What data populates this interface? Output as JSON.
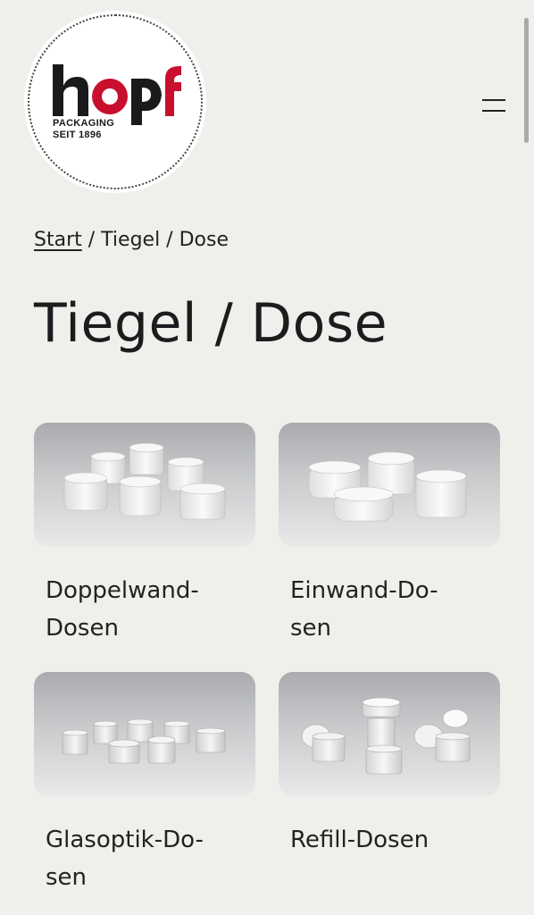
{
  "header": {
    "logo": {
      "wordmark": "hopf",
      "tagline_line1": "PACKAGING",
      "tagline_line2": "SEIT 1896"
    },
    "menu_icon": "hamburger-icon"
  },
  "breadcrumb": {
    "home_label": "Start",
    "separator": " / ",
    "current_label": "Tiegel / Dose"
  },
  "page_title": "Tiegel / Dose",
  "categories": [
    {
      "label": "Doppelwand-\nDosen",
      "image": "double-wall-jars-photo"
    },
    {
      "label": "Einwand-Do-\nsen",
      "image": "single-wall-jars-photo"
    },
    {
      "label": "Glasoptik-Do-\nsen",
      "image": "glass-look-jars-photo"
    },
    {
      "label": "Refill-Dosen",
      "image": "refill-jars-photo"
    }
  ],
  "colors": {
    "background": "#f0efeb",
    "logo_red": "#c8102e",
    "text": "#1d1d1f"
  }
}
